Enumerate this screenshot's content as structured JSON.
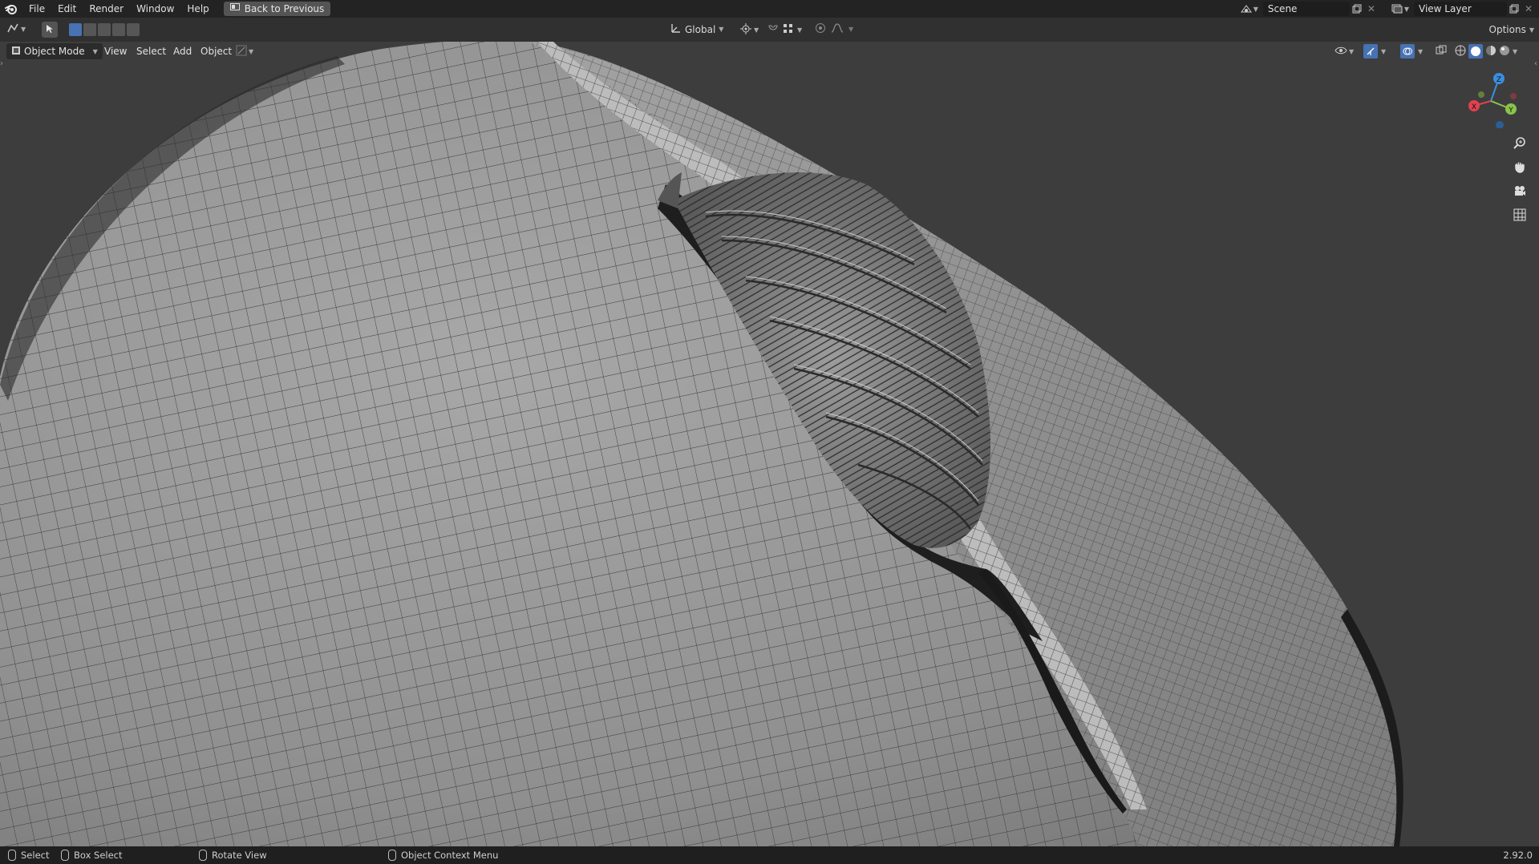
{
  "menu": {
    "items": [
      "File",
      "Edit",
      "Render",
      "Window",
      "Help"
    ],
    "back_label": "Back to Previous"
  },
  "top_right": {
    "scene_label": "Scene",
    "view_layer_label": "View Layer"
  },
  "toolbar": {
    "orientation_label": "Global",
    "options_label": "Options"
  },
  "header": {
    "mode_label": "Object Mode",
    "view_label": "View",
    "select_label": "Select",
    "add_label": "Add",
    "object_label": "Object"
  },
  "gizmo": {
    "z_label": "Z",
    "x_label": "X",
    "y_label": "Y",
    "x_color": "#e14250",
    "y_color": "#8bc34a",
    "z_color": "#3b8ede"
  },
  "statusbar": {
    "select_label": "Select",
    "box_select_label": "Box Select",
    "rotate_label": "Rotate View",
    "context_label": "Object Context Menu",
    "version": "2.92.0"
  },
  "colors": {
    "topbar": "#232323",
    "viewport_bg": "#3d3d3d",
    "mesh_light": "#9a9a9a",
    "mesh_dark": "#5a5a5a",
    "accent": "#4772b3"
  }
}
